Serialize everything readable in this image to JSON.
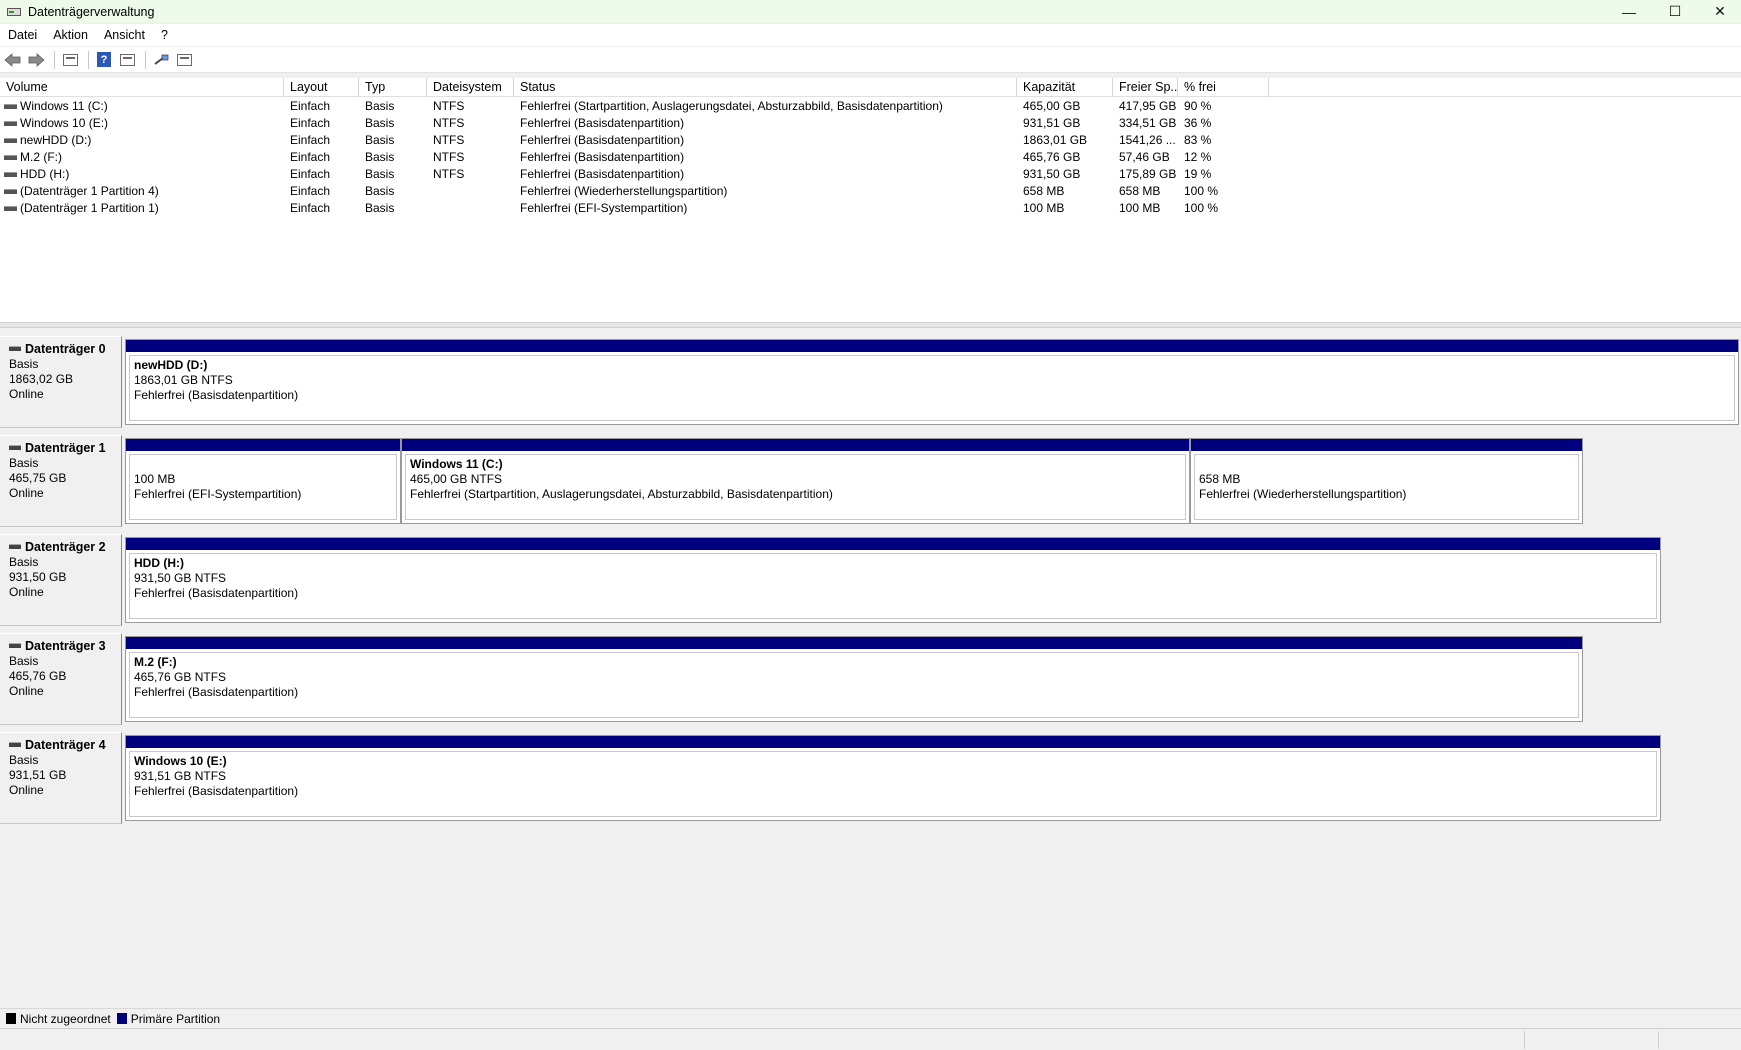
{
  "window": {
    "title": "Datenträgerverwaltung",
    "minimize_glyph": "—",
    "maximize_glyph": "☐",
    "close_glyph": "✕"
  },
  "menu": [
    "Datei",
    "Aktion",
    "Ansicht",
    "?"
  ],
  "toolbar": {
    "icons": [
      "back-arrow-icon",
      "forward-arrow-icon",
      "console-tree-icon",
      "help-icon",
      "properties-icon",
      "connect-icon",
      "list-view-icon"
    ],
    "help_glyph": "?"
  },
  "volume_list": {
    "headers": [
      "Volume",
      "Layout",
      "Typ",
      "Dateisystem",
      "Status",
      "Kapazität",
      "Freier Sp...",
      "% frei"
    ],
    "rows": [
      {
        "volume": "Windows 11 (C:)",
        "layout": "Einfach",
        "typ": "Basis",
        "fs": "NTFS",
        "status": "Fehlerfrei (Startpartition, Auslagerungsdatei, Absturzabbild, Basisdatenpartition)",
        "kapazitaet": "465,00 GB",
        "frei": "417,95 GB",
        "prozent": "90 %"
      },
      {
        "volume": "Windows 10 (E:)",
        "layout": "Einfach",
        "typ": "Basis",
        "fs": "NTFS",
        "status": "Fehlerfrei (Basisdatenpartition)",
        "kapazitaet": "931,51 GB",
        "frei": "334,51 GB",
        "prozent": "36 %"
      },
      {
        "volume": "newHDD (D:)",
        "layout": "Einfach",
        "typ": "Basis",
        "fs": "NTFS",
        "status": "Fehlerfrei (Basisdatenpartition)",
        "kapazitaet": "1863,01 GB",
        "frei": "1541,26 ...",
        "prozent": "83 %"
      },
      {
        "volume": "M.2 (F:)",
        "layout": "Einfach",
        "typ": "Basis",
        "fs": "NTFS",
        "status": "Fehlerfrei (Basisdatenpartition)",
        "kapazitaet": "465,76 GB",
        "frei": "57,46 GB",
        "prozent": "12 %"
      },
      {
        "volume": "HDD (H:)",
        "layout": "Einfach",
        "typ": "Basis",
        "fs": "NTFS",
        "status": "Fehlerfrei (Basisdatenpartition)",
        "kapazitaet": "931,50 GB",
        "frei": "175,89 GB",
        "prozent": "19 %"
      },
      {
        "volume": "(Datenträger 1 Partition 4)",
        "layout": "Einfach",
        "typ": "Basis",
        "fs": "",
        "status": "Fehlerfrei (Wiederherstellungspartition)",
        "kapazitaet": "658 MB",
        "frei": "658 MB",
        "prozent": "100 %"
      },
      {
        "volume": "(Datenträger 1 Partition 1)",
        "layout": "Einfach",
        "typ": "Basis",
        "fs": "",
        "status": "Fehlerfrei (EFI-Systempartition)",
        "kapazitaet": "100 MB",
        "frei": "100 MB",
        "prozent": "100 %"
      }
    ]
  },
  "disks": [
    {
      "name": "Datenträger 0",
      "type": "Basis",
      "size": "1863,02 GB",
      "state": "Online",
      "partitions": [
        {
          "title": "newHDD  (D:)",
          "size": "1863,01 GB NTFS",
          "status": "Fehlerfrei (Basisdatenpartition)"
        }
      ]
    },
    {
      "name": "Datenträger 1",
      "type": "Basis",
      "size": "465,75 GB",
      "state": "Online",
      "partitions": [
        {
          "title": "",
          "size": "100 MB",
          "status": "Fehlerfrei (EFI-Systempartition)"
        },
        {
          "title": "Windows 11  (C:)",
          "size": "465,00 GB NTFS",
          "status": "Fehlerfrei (Startpartition, Auslagerungsdatei, Absturzabbild, Basisdatenpartition)"
        },
        {
          "title": "",
          "size": "658 MB",
          "status": "Fehlerfrei (Wiederherstellungspartition)"
        }
      ]
    },
    {
      "name": "Datenträger 2",
      "type": "Basis",
      "size": "931,50 GB",
      "state": "Online",
      "partitions": [
        {
          "title": "HDD  (H:)",
          "size": "931,50 GB NTFS",
          "status": "Fehlerfrei (Basisdatenpartition)"
        }
      ]
    },
    {
      "name": "Datenträger 3",
      "type": "Basis",
      "size": "465,76 GB",
      "state": "Online",
      "partitions": [
        {
          "title": "M.2  (F:)",
          "size": "465,76 GB NTFS",
          "status": "Fehlerfrei (Basisdatenpartition)"
        }
      ]
    },
    {
      "name": "Datenträger 4",
      "type": "Basis",
      "size": "931,51 GB",
      "state": "Online",
      "partitions": [
        {
          "title": "Windows 10  (E:)",
          "size": "931,51 GB NTFS",
          "status": "Fehlerfrei (Basisdatenpartition)"
        }
      ]
    }
  ],
  "legend": [
    {
      "label": "Nicht zugeordnet",
      "color": "#000000"
    },
    {
      "label": "Primäre Partition",
      "color": "#00007f"
    }
  ],
  "colors": {
    "partition_bar": "#00007f",
    "titlebar": "#eefaea"
  }
}
